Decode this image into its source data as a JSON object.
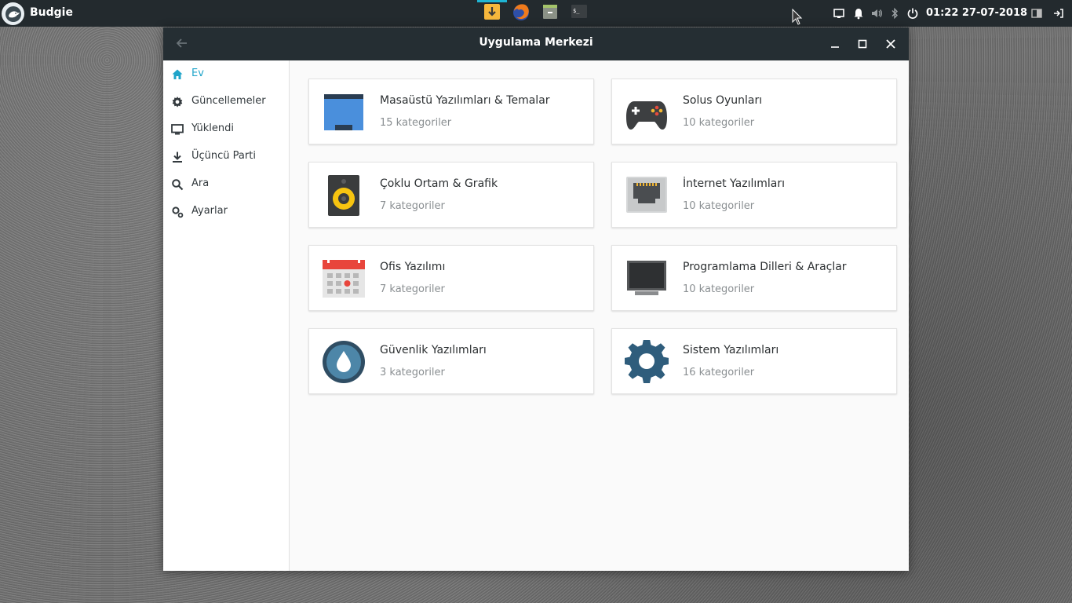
{
  "panel": {
    "app_name": "Budgie",
    "clock": "01:22 27-07-2018"
  },
  "window": {
    "title": "Uygulama Merkezi"
  },
  "sidebar": {
    "items": [
      {
        "label": "Ev",
        "icon": "home-icon",
        "active": true
      },
      {
        "label": "Güncellemeler",
        "icon": "gear-icon"
      },
      {
        "label": "Yüklendi",
        "icon": "monitor-icon"
      },
      {
        "label": "Üçüncü Parti",
        "icon": "download-icon"
      },
      {
        "label": "Ara",
        "icon": "search-icon"
      },
      {
        "label": "Ayarlar",
        "icon": "settings-icon"
      }
    ]
  },
  "categories": [
    {
      "title": "Masaüstü Yazılımları & Temalar",
      "subtitle": "15 kategoriler",
      "icon": "desktop-window-icon"
    },
    {
      "title": "Solus Oyunları",
      "subtitle": "10 kategoriler",
      "icon": "gamepad-icon"
    },
    {
      "title": "Çoklu Ortam & Grafik",
      "subtitle": "7 kategoriler",
      "icon": "speaker-icon"
    },
    {
      "title": "İnternet Yazılımları",
      "subtitle": "10 kategoriler",
      "icon": "network-port-icon"
    },
    {
      "title": "Ofis Yazılımı",
      "subtitle": "7 kategoriler",
      "icon": "calendar-icon"
    },
    {
      "title": "Programlama Dilleri & Araçlar",
      "subtitle": "10 kategoriler",
      "icon": "monitor-icon"
    },
    {
      "title": "Güvenlik Yazılımları",
      "subtitle": "3 kategoriler",
      "icon": "security-drop-icon"
    },
    {
      "title": "Sistem Yazılımları",
      "subtitle": "16 kategoriler",
      "icon": "system-gear-icon"
    }
  ],
  "colors": {
    "accent": "#1fa4c9",
    "panel": "#232a2e",
    "titlebar": "#252e33"
  }
}
